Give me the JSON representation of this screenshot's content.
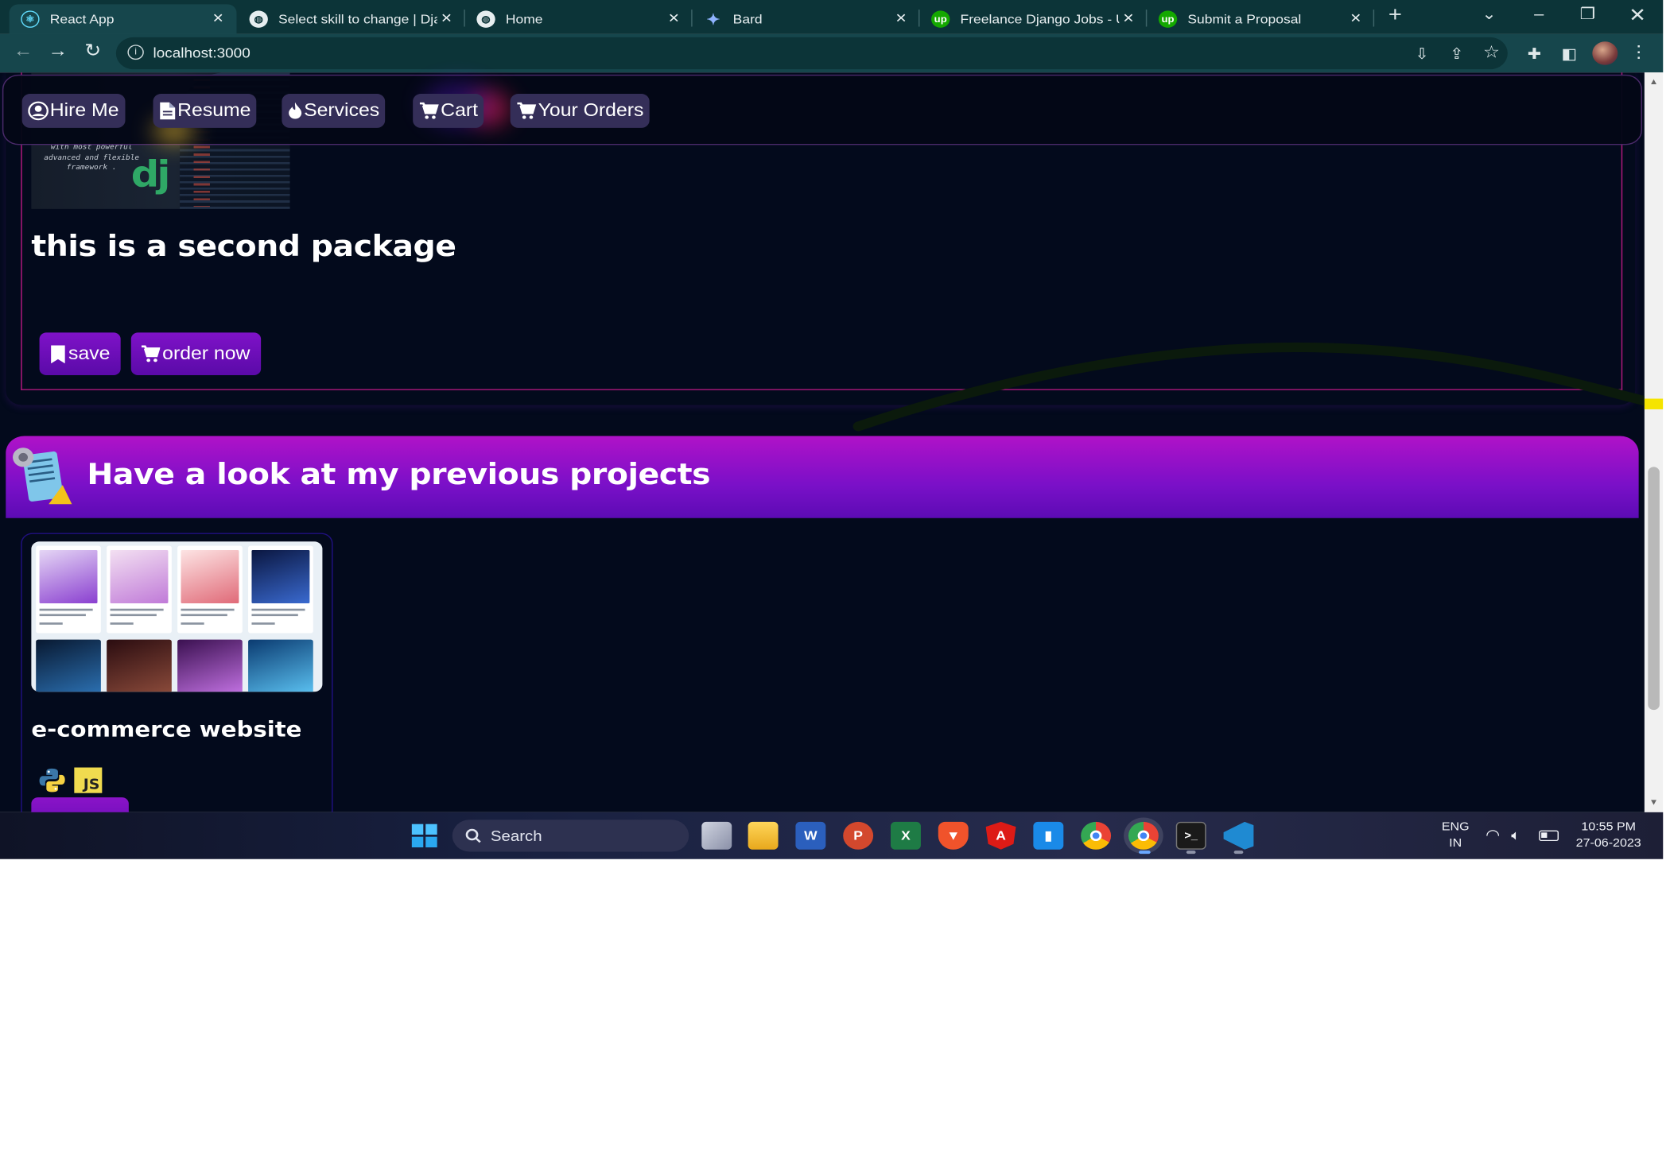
{
  "browser": {
    "tabs": [
      {
        "title": "React App",
        "active": true
      },
      {
        "title": "Select skill to change | Djan"
      },
      {
        "title": "Home"
      },
      {
        "title": "Bard"
      },
      {
        "title": "Freelance Django Jobs - Up"
      },
      {
        "title": "Submit a Proposal"
      }
    ],
    "url": "localhost:3000"
  },
  "navbar": {
    "items": [
      {
        "label": "Hire Me",
        "icon": "user-circle-icon"
      },
      {
        "label": "Resume",
        "icon": "file-icon"
      },
      {
        "label": "Services",
        "icon": "fire-icon"
      },
      {
        "label": "Cart",
        "icon": "cart-icon"
      },
      {
        "label": "Your Orders",
        "icon": "cart-icon"
      }
    ]
  },
  "package": {
    "image_text": "with most powerful advanced and flexible framework .",
    "logo_text": "dj",
    "title": "this is a second package",
    "save_label": "save",
    "order_label": "order now"
  },
  "projects": {
    "heading": "Have a look at my previous projects",
    "items": [
      {
        "name": "e-commerce website",
        "tech": [
          "python-icon",
          "js-icon"
        ],
        "js_badge": "JS"
      }
    ]
  },
  "taskbar": {
    "search_label": "Search",
    "lang_top": "ENG",
    "lang_bottom": "IN",
    "time": "10:55 PM",
    "date": "27-06-2023"
  },
  "colors": {
    "page_bg": "#030a1c",
    "accent_purple": "#7a10c8",
    "header_magenta": "#b012c8",
    "chrome_teal": "#16464c"
  }
}
